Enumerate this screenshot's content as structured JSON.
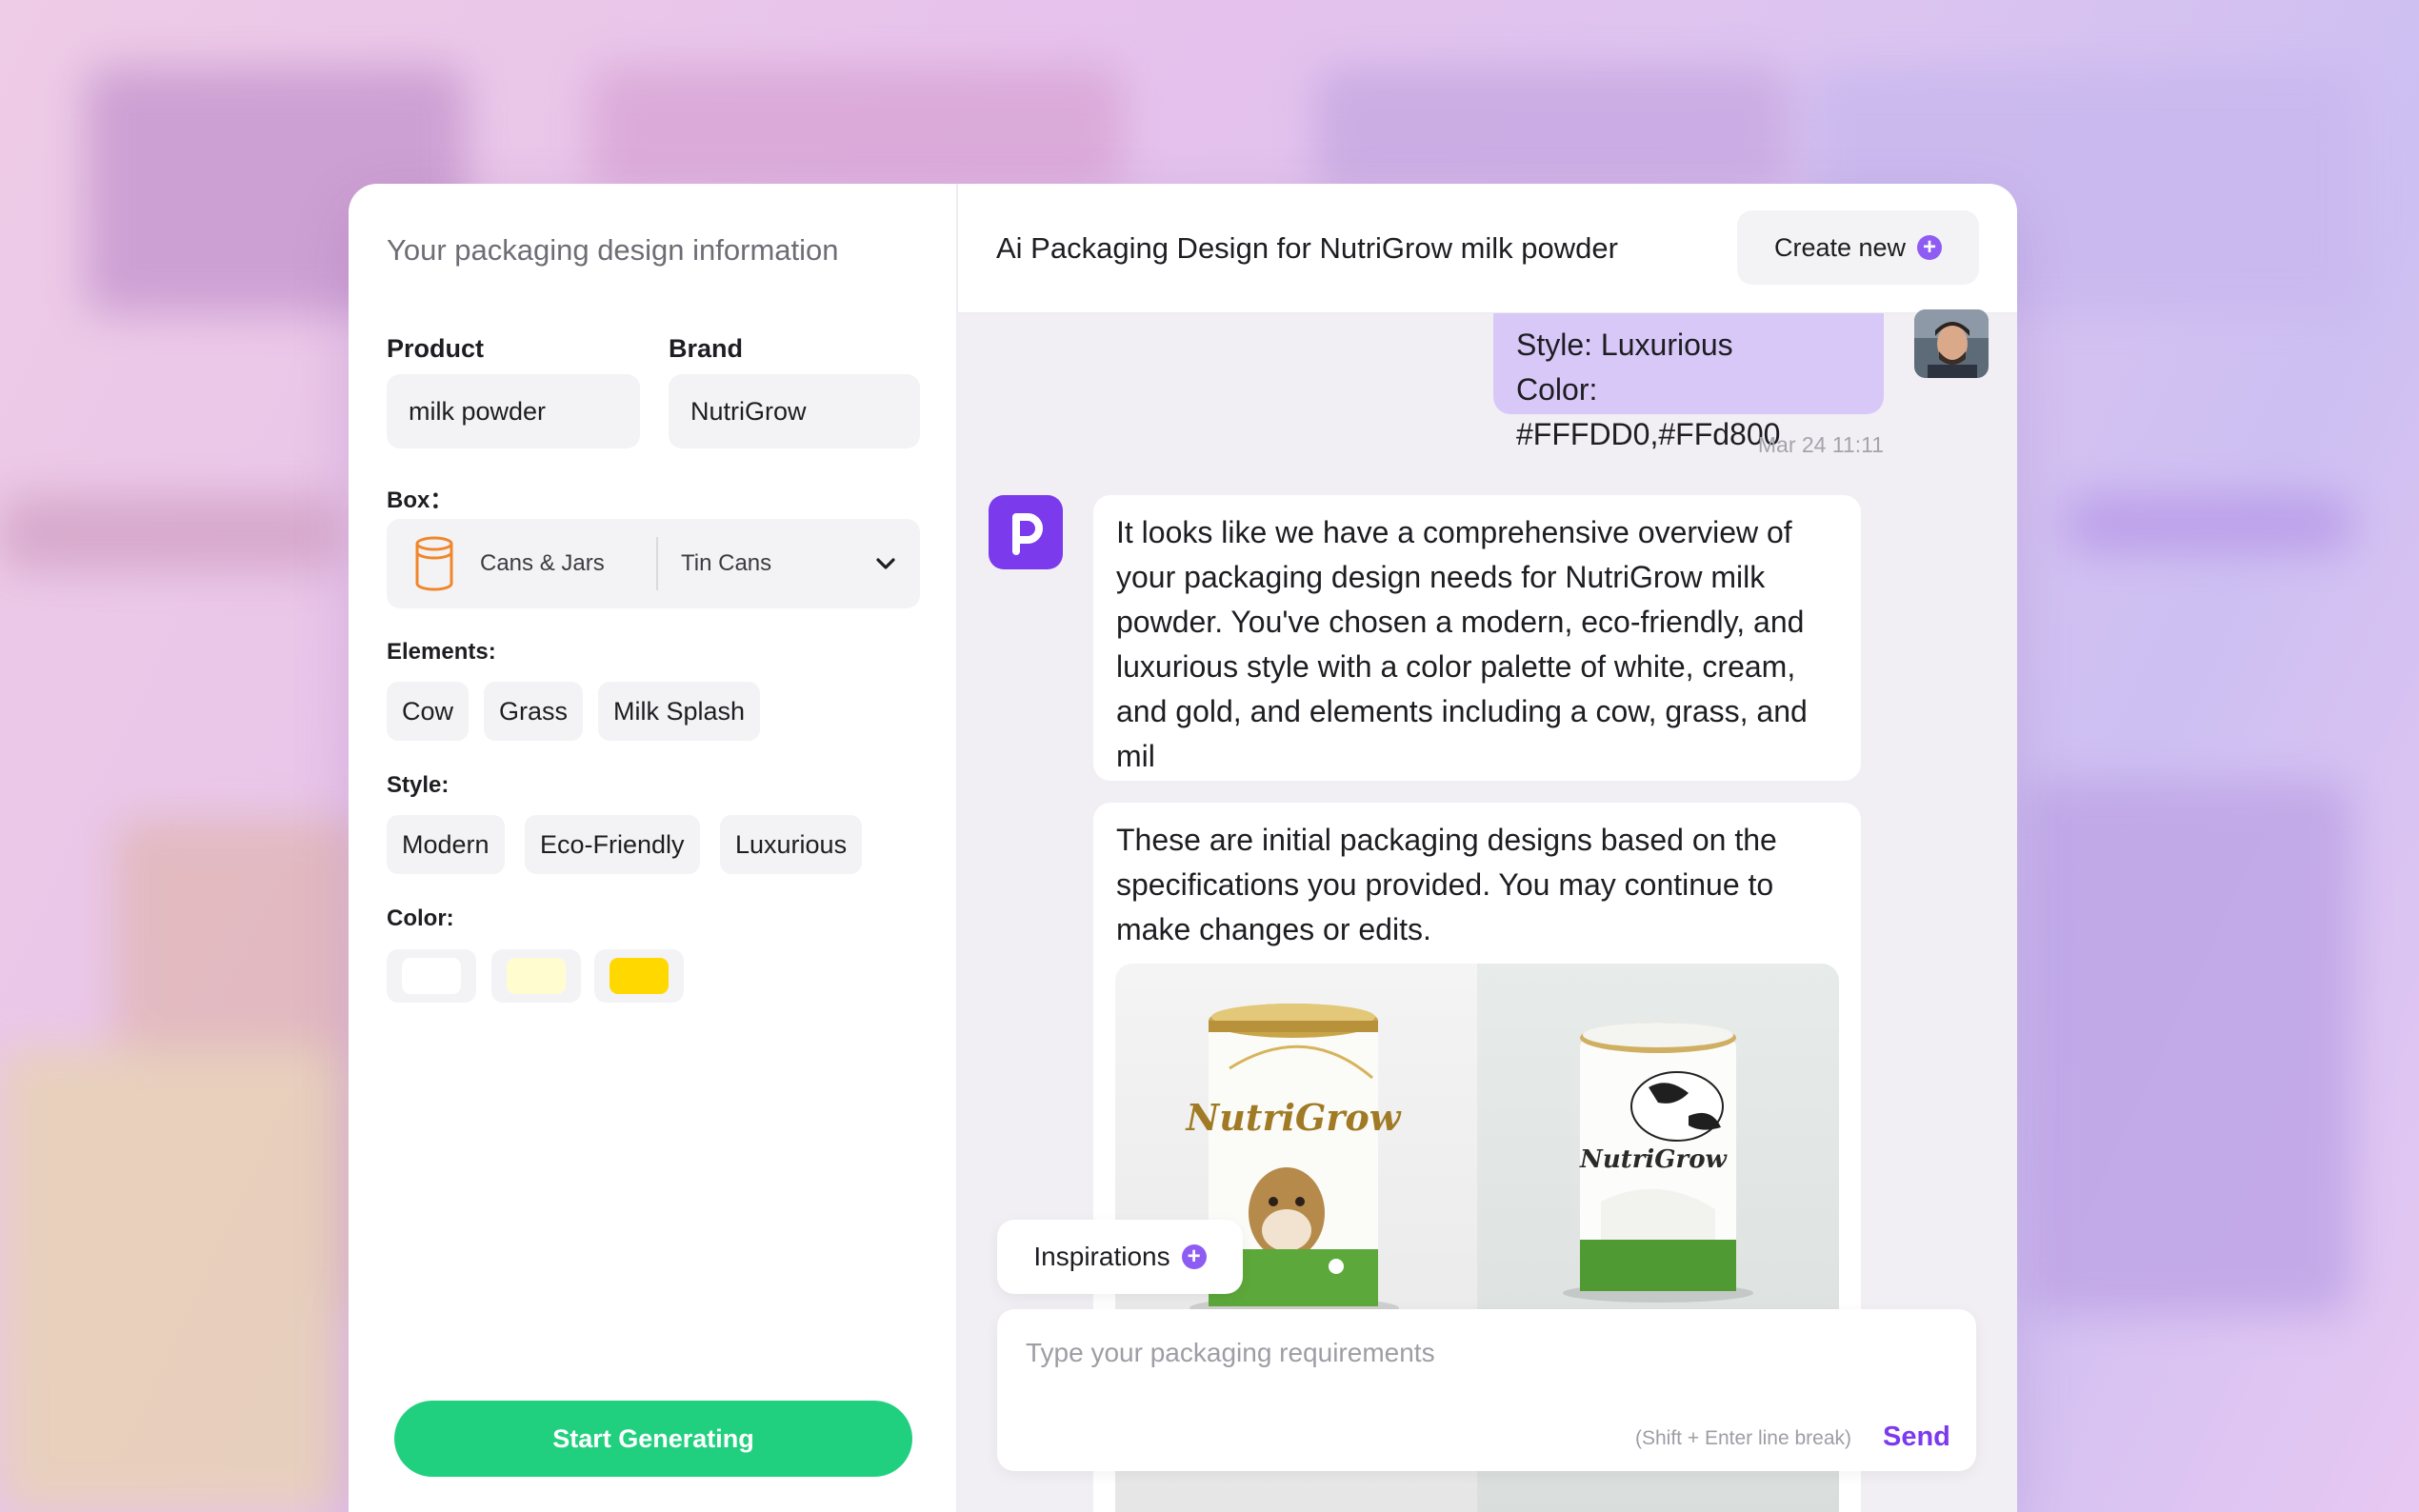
{
  "left_panel": {
    "title": "Your packaging design information",
    "product": {
      "label": "Product",
      "value": "milk powder"
    },
    "brand": {
      "label": "Brand",
      "value": "NutriGrow"
    },
    "box": {
      "label": "Box：",
      "category": "Cans & Jars",
      "type": "Tin Cans",
      "icon": "can-icon"
    },
    "elements": {
      "label": "Elements:",
      "items": [
        "Cow",
        "Grass",
        "Milk Splash"
      ]
    },
    "style": {
      "label": "Style:",
      "items": [
        "Modern",
        "Eco-Friendly",
        "Luxurious"
      ]
    },
    "color": {
      "label": "Color:",
      "swatches": [
        "#FFFFFF",
        "#FFFDD0",
        "#FFD800"
      ]
    },
    "generate_button": "Start Generating"
  },
  "header": {
    "title": "Ai Packaging Design for NutriGrow milk powder",
    "create_button": "Create new"
  },
  "chat": {
    "user_message": {
      "line1": "Style: Luxurious",
      "line2": "Color: #FFFDD0,#FFd800",
      "timestamp": "Mar 24 11:11"
    },
    "bot_message_1": "It looks like we have a comprehensive overview of your packaging design needs for NutriGrow milk powder. You've chosen a modern, eco-friendly, and luxurious style with a color palette of white, cream, and gold, and elements including a cow, grass, and mil",
    "bot_message_2": "These are initial packaging designs based on the specifications you provided. You may continue to make changes or edits.",
    "design_images": [
      {
        "brand_text": "NutriGrow"
      },
      {
        "brand_text": "NutriGrow"
      }
    ]
  },
  "composer": {
    "inspirations_button": "Inspirations",
    "placeholder": "Type your packaging requirements",
    "hint": "(Shift + Enter line break)",
    "send_button": "Send"
  },
  "colors": {
    "accent": "#7c3aed",
    "generate": "#21d07f",
    "user_bubble": "#d8c8f8"
  }
}
